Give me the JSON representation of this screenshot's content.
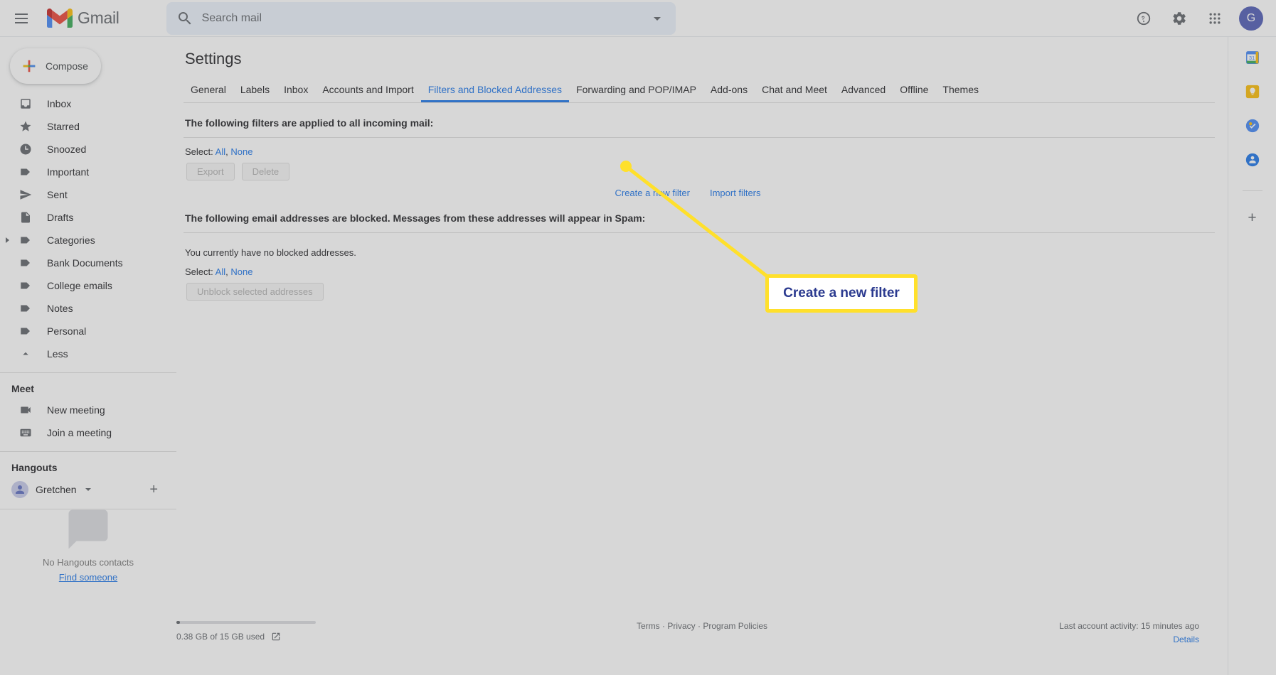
{
  "header": {
    "menu_icon": "hamburger-icon",
    "brand": "Gmail",
    "search": {
      "placeholder": "Search mail",
      "value": "",
      "search_icon": "search-icon",
      "options_icon": "chevron-down-icon"
    },
    "help_icon": "help-icon",
    "settings_icon": "gear-icon",
    "apps_icon": "apps-grid-icon",
    "avatar_initial": "G"
  },
  "sidebar": {
    "compose_label": "Compose",
    "items": [
      {
        "label": "Inbox",
        "icon": "inbox-icon"
      },
      {
        "label": "Starred",
        "icon": "star-icon"
      },
      {
        "label": "Snoozed",
        "icon": "clock-icon"
      },
      {
        "label": "Important",
        "icon": "important-marker-icon"
      },
      {
        "label": "Sent",
        "icon": "send-icon"
      },
      {
        "label": "Drafts",
        "icon": "document-icon"
      },
      {
        "label": "Categories",
        "icon": "label-icon"
      },
      {
        "label": "Bank Documents",
        "icon": "label-icon"
      },
      {
        "label": "College emails",
        "icon": "label-icon"
      },
      {
        "label": "Notes",
        "icon": "label-icon"
      },
      {
        "label": "Personal",
        "icon": "label-icon"
      },
      {
        "label": "Less",
        "icon": "chevron-up-icon"
      }
    ],
    "meet": {
      "title": "Meet",
      "items": [
        {
          "label": "New meeting",
          "icon": "video-camera-icon"
        },
        {
          "label": "Join a meeting",
          "icon": "keyboard-icon"
        }
      ]
    },
    "hangouts": {
      "title": "Hangouts",
      "user": "Gretchen",
      "status_caret": "chevron-down-icon",
      "add_icon": "plus-icon",
      "empty_text": "No Hangouts contacts",
      "find_link": "Find someone"
    }
  },
  "main": {
    "page_title": "Settings",
    "tabs": [
      "General",
      "Labels",
      "Inbox",
      "Accounts and Import",
      "Filters and Blocked Addresses",
      "Forwarding and POP/IMAP",
      "Add-ons",
      "Chat and Meet",
      "Advanced",
      "Offline",
      "Themes"
    ],
    "active_tab": "Filters and Blocked Addresses",
    "filters_section": {
      "heading": "The following filters are applied to all incoming mail:",
      "select_label": "Select:",
      "select_all": "All",
      "select_separator": ",",
      "select_none": "None",
      "buttons": [
        {
          "label": "Export",
          "disabled": true
        },
        {
          "label": "Delete",
          "disabled": true
        }
      ],
      "links": [
        "Create a new filter",
        "Import filters"
      ]
    },
    "blocked_section": {
      "heading": "The following email addresses are blocked. Messages from these addresses will appear in Spam:",
      "empty_text": "You currently have no blocked addresses.",
      "select_label": "Select:",
      "select_all": "All",
      "select_separator": ",",
      "select_none": "None",
      "unblock_button": "Unblock selected addresses"
    }
  },
  "footer": {
    "storage_text": "0.38 GB of 15 GB used",
    "storage_icon": "external-link-icon",
    "links": [
      "Terms",
      "Privacy",
      "Program Policies"
    ],
    "link_separator": "·",
    "activity_text": "Last account activity: 15 minutes ago",
    "details_link": "Details"
  },
  "rail": {
    "icons": [
      "google-calendar-icon",
      "google-keep-icon",
      "google-tasks-icon",
      "google-contacts-icon"
    ],
    "add_icon": "plus-icon"
  },
  "annotation": {
    "callout_text": "Create a new filter",
    "highlight_color": "#ffe02b",
    "callout_text_color": "#2b3a8f"
  }
}
